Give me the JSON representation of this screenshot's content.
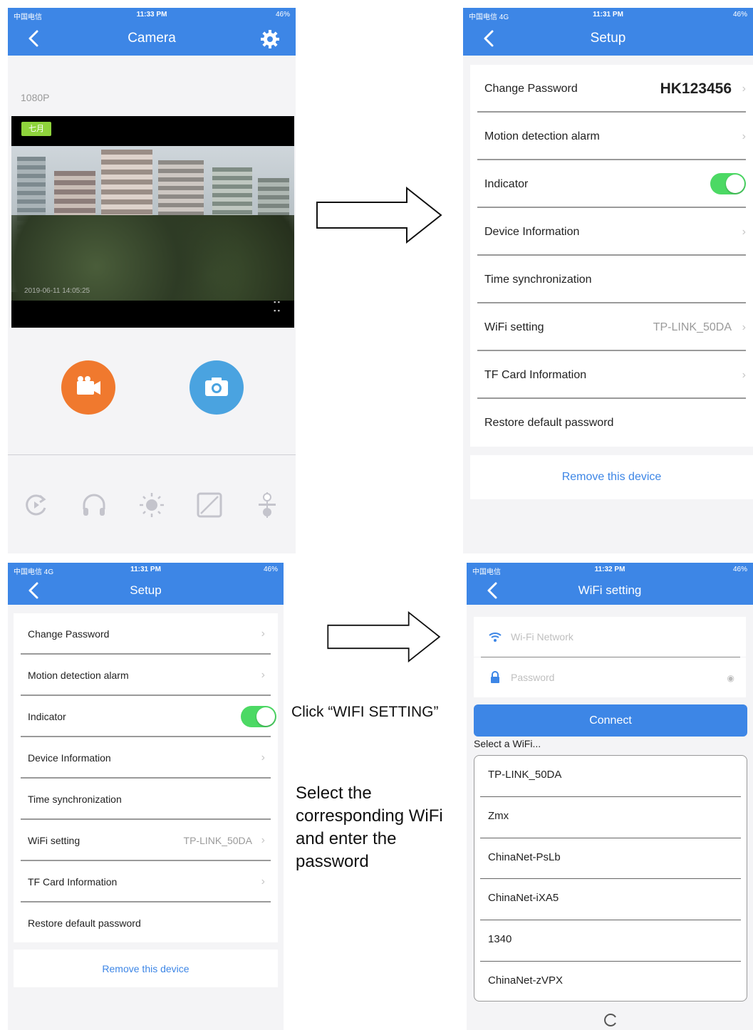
{
  "panel_camera": {
    "status": {
      "carrier": "中国电信",
      "time": "11:33 PM",
      "battery": "46%"
    },
    "title": "Camera",
    "resolution": "1080P",
    "video_badge": "七月",
    "video_timestamp": "2019-06-11 14:05:25",
    "toolbar_icons": [
      "rotate-icon",
      "headphones-icon",
      "brightness-icon",
      "contrast-icon",
      "tuning-icon"
    ]
  },
  "panel_setup_top": {
    "status": {
      "carrier": "中国电信 4G",
      "time": "11:31 PM",
      "battery": "46%"
    },
    "title": "Setup",
    "rows": [
      {
        "label": "Change Password",
        "value": "HK123456",
        "chevron": true
      },
      {
        "label": "Motion detection alarm",
        "value": "",
        "chevron": true
      },
      {
        "label": "Indicator",
        "toggle": true
      },
      {
        "label": "Device Information",
        "value": "",
        "chevron": true
      },
      {
        "label": "Time synchronization",
        "value": "",
        "chevron": false
      },
      {
        "label": "WiFi setting",
        "value": "TP-LINK_50DA",
        "chevron": true
      },
      {
        "label": "TF Card Information",
        "value": "",
        "chevron": true
      },
      {
        "label": "Restore default password",
        "value": "",
        "chevron": false
      }
    ],
    "remove_label": "Remove this device"
  },
  "panel_setup_bottom": {
    "status": {
      "carrier": "中国电信 4G",
      "time": "11:31 PM",
      "battery": "46%"
    },
    "title": "Setup",
    "rows": [
      {
        "label": "Change Password",
        "value": "",
        "chevron": true
      },
      {
        "label": "Motion detection alarm",
        "value": "",
        "chevron": true
      },
      {
        "label": "Indicator",
        "toggle": true
      },
      {
        "label": "Device Information",
        "value": "",
        "chevron": true
      },
      {
        "label": "Time synchronization",
        "value": "",
        "chevron": false
      },
      {
        "label": "WiFi setting",
        "value": "TP-LINK_50DA",
        "chevron": true
      },
      {
        "label": "TF Card Information",
        "value": "",
        "chevron": true
      },
      {
        "label": "Restore default password",
        "value": "",
        "chevron": false
      }
    ],
    "remove_label": "Remove this device"
  },
  "instructions": {
    "click_wifi": "Click “WIFI SETTING”",
    "select_line1": "Select the",
    "select_line2": "corresponding WiFi",
    "select_line3": "and enter the",
    "select_line4": "password"
  },
  "panel_wifi": {
    "status": {
      "carrier": "中国电信",
      "time": "11:32 PM",
      "battery": "46%"
    },
    "title": "WiFi setting",
    "network_placeholder": "Wi-Fi Network",
    "password_placeholder": "Password",
    "connect_label": "Connect",
    "select_label": "Select a WiFi...",
    "networks": [
      "TP-LINK_50DA",
      "Zmx",
      "ChinaNet-PsLb",
      "ChinaNet-iXA5",
      "1340",
      "ChinaNet-zVPX"
    ]
  },
  "colors": {
    "brand_blue": "#3d86e6",
    "toggle_green": "#4cd964",
    "record_orange": "#f0792e",
    "snapshot_blue": "#4aa3e0"
  }
}
